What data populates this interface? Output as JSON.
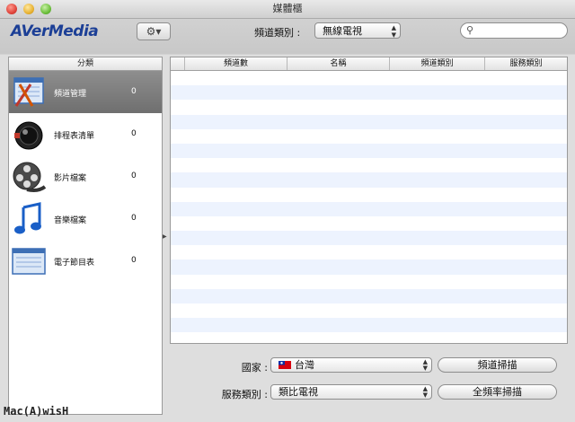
{
  "window": {
    "title": "媒體櫃"
  },
  "toolbar": {
    "logo": "AVerMedia",
    "gear_arrow": "▾",
    "category_label": "頻道類別 :",
    "category_value": "無線電視"
  },
  "sidebar": {
    "header": "分類",
    "items": [
      {
        "label": "頻道管理",
        "count": "0",
        "icon": "channel-manager-icon",
        "selected": true
      },
      {
        "label": "排程表清單",
        "count": "0",
        "icon": "schedule-list-icon"
      },
      {
        "label": "影片檔案",
        "count": "0",
        "icon": "film-reel-icon"
      },
      {
        "label": "音樂檔案",
        "count": "0",
        "icon": "music-note-icon"
      },
      {
        "label": "電子節目表",
        "count": "0",
        "icon": "epg-icon"
      }
    ]
  },
  "table": {
    "columns": [
      "",
      "頻道數",
      "名稱",
      "頻道類別",
      "服務類別"
    ],
    "rows": []
  },
  "bottom": {
    "country_label": "國家 :",
    "country_value": "台灣",
    "service_label": "服務類別 :",
    "service_value": "類比電視",
    "scan_button": "頻道掃描",
    "full_scan_button": "全頻率掃描"
  },
  "watermark": "Mac(A)wisH",
  "colors": {
    "selected_row": "#7f7f7f",
    "alt_row": "#edf3fe",
    "logo": "#1c3f96"
  }
}
